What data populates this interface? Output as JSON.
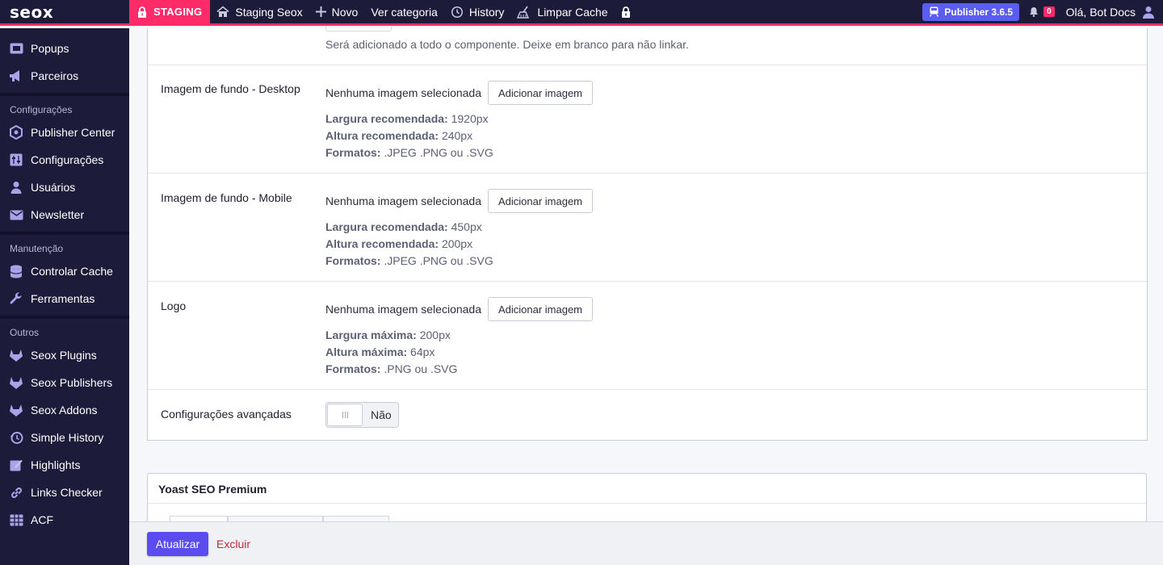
{
  "topbar": {
    "brand": "seox",
    "staging_label": "STAGING",
    "site_name": "Staging Seox",
    "new_label": "Novo",
    "view_category_label": "Ver categoria",
    "history_label": "History",
    "clear_cache_label": "Limpar Cache",
    "publisher_version": "Publisher 3.6.5",
    "notification_count": "0",
    "greeting": "Olá, Bot Docs"
  },
  "sidebar": {
    "items_top": [
      {
        "label": "Popups",
        "icon": "popup-icon"
      },
      {
        "label": "Parceiros",
        "icon": "megaphone-icon"
      }
    ],
    "sections": [
      {
        "title": "Configurações",
        "items": [
          {
            "label": "Publisher Center",
            "icon": "puzzle-icon"
          },
          {
            "label": "Configurações",
            "icon": "sliders-icon"
          },
          {
            "label": "Usuários",
            "icon": "user-icon"
          },
          {
            "label": "Newsletter",
            "icon": "envelope-icon"
          }
        ]
      },
      {
        "title": "Manutenção",
        "items": [
          {
            "label": "Controlar Cache",
            "icon": "database-icon"
          },
          {
            "label": "Ferramentas",
            "icon": "wrench-icon"
          }
        ]
      },
      {
        "title": "Outros",
        "items": [
          {
            "label": "Seox Plugins",
            "icon": "gitlab-icon"
          },
          {
            "label": "Seox Publishers",
            "icon": "gitlab-icon"
          },
          {
            "label": "Seox Addons",
            "icon": "gitlab-icon"
          },
          {
            "label": "Simple History",
            "icon": "history-icon"
          },
          {
            "label": "Highlights",
            "icon": "highlight-icon"
          },
          {
            "label": "Links Checker",
            "icon": "link-icon"
          },
          {
            "label": "ACF",
            "icon": "grid-icon"
          }
        ]
      }
    ]
  },
  "form": {
    "link_hint": "Será adicionado a todo o componente. Deixe em branco para não linkar.",
    "no_image": "Nenhuma imagem selecionada",
    "add_image": "Adicionar imagem",
    "desktop": {
      "label": "Imagem de fundo - Desktop",
      "width_label": "Largura recomendada:",
      "width_value": "1920px",
      "height_label": "Altura recomendada:",
      "height_value": "240px",
      "formats_label": "Formatos:",
      "formats_value": ".JPEG .PNG ou .SVG"
    },
    "mobile": {
      "label": "Imagem de fundo - Mobile",
      "width_label": "Largura recomendada:",
      "width_value": "450px",
      "height_label": "Altura recomendada:",
      "height_value": "200px",
      "formats_label": "Formatos:",
      "formats_value": ".JPEG .PNG ou .SVG"
    },
    "logo": {
      "label": "Logo",
      "width_label": "Largura máxima:",
      "width_value": "200px",
      "height_label": "Altura máxima:",
      "height_value": "64px",
      "formats_label": "Formatos:",
      "formats_value": ".PNG ou .SVG"
    },
    "advanced": {
      "label": "Configurações avançadas",
      "toggle_value": "Não"
    }
  },
  "yoast": {
    "title": "Yoast SEO Premium"
  },
  "footer": {
    "update_label": "Atualizar",
    "delete_label": "Excluir"
  },
  "colors": {
    "admin_bar": "#1c1b3a",
    "accent_pink": "#ff2a68",
    "primary_purple": "#5b4cf0",
    "publisher_badge": "#5b5cf0",
    "delete_red": "#c0283d"
  }
}
